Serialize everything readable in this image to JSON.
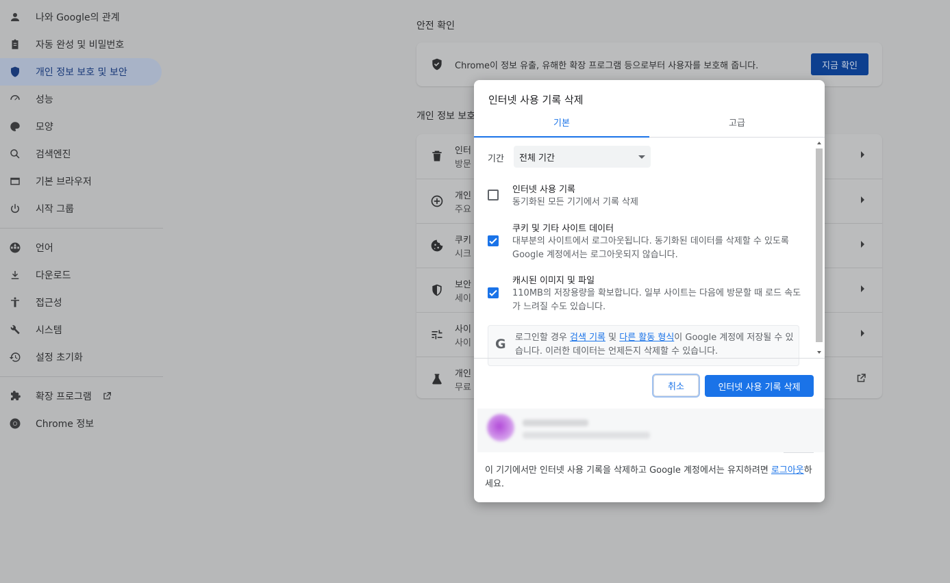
{
  "sidebar": {
    "items": [
      {
        "label": "나와 Google의 관계",
        "icon": "person-icon"
      },
      {
        "label": "자동 완성 및 비밀번호",
        "icon": "clipboard-icon"
      },
      {
        "label": "개인 정보 보호 및 보안",
        "icon": "shield-icon",
        "active": true
      },
      {
        "label": "성능",
        "icon": "speedometer-icon"
      },
      {
        "label": "모양",
        "icon": "palette-icon"
      },
      {
        "label": "검색엔진",
        "icon": "search-icon"
      },
      {
        "label": "기본 브라우저",
        "icon": "browser-icon"
      },
      {
        "label": "시작 그룹",
        "icon": "power-icon"
      },
      {
        "label": "언어",
        "icon": "globe-icon"
      },
      {
        "label": "다운로드",
        "icon": "download-icon"
      },
      {
        "label": "접근성",
        "icon": "accessibility-icon"
      },
      {
        "label": "시스템",
        "icon": "wrench-icon"
      },
      {
        "label": "설정 초기화",
        "icon": "history-icon"
      },
      {
        "label": "확장 프로그램",
        "icon": "puzzle-icon"
      },
      {
        "label": "Chrome 정보",
        "icon": "chrome-icon"
      }
    ]
  },
  "main": {
    "safety_title": "안전 확인",
    "safety_text": "Chrome이 정보 유출, 유해한 확장 프로그램 등으로부터 사용자를 보호해 줍니다.",
    "safety_button": "지금 확인",
    "privacy_title": "개인 정보 보호",
    "privacy_rows": [
      {
        "t1": "인터",
        "t2": "방문",
        "icon": "trash-icon"
      },
      {
        "t1": "개인",
        "t2": "주요",
        "icon": "compass-icon"
      },
      {
        "t1": "쿠키",
        "t2": "시크",
        "icon": "cookie-icon"
      },
      {
        "t1": "보안",
        "t2": "세이",
        "icon": "shield-icon"
      },
      {
        "t1": "사이",
        "t2": "사이",
        "icon": "tune-icon"
      },
      {
        "t1": "개인",
        "t2": "무료",
        "icon": "flask-icon"
      }
    ]
  },
  "dialog": {
    "title": "인터넷 사용 기록 삭제",
    "tabs": [
      "기본",
      "고급"
    ],
    "range_label": "기간",
    "range_value": "전체 기간",
    "options": [
      {
        "title": "인터넷 사용 기록",
        "desc": "동기화된 모든 기기에서 기록 삭제",
        "checked": false
      },
      {
        "title": "쿠키 및 기타 사이트 데이터",
        "desc": "대부분의 사이트에서 로그아웃됩니다. 동기화된 데이터를 삭제할 수 있도록 Google 계정에서는 로그아웃되지 않습니다.",
        "checked": true
      },
      {
        "title": "캐시된 이미지 및 파일",
        "desc": "110MB의 저장용량을 확보합니다. 일부 사이트는 다음에 방문할 때 로드 속도가 느려질 수도 있습니다.",
        "checked": true
      }
    ],
    "google_note": {
      "pre": "로그인할 경우 ",
      "link1": "검색 기록",
      "mid": " 및 ",
      "link2": "다른 활동 형식",
      "post": "이 Google 계정에 저장될 수 있습니다. 이러한 데이터는 언제든지 삭제할 수 있습니다."
    },
    "cancel": "취소",
    "confirm": "인터넷 사용 기록 삭제",
    "signout_pre": "이 기기에서만 인터넷 사용 기록을 삭제하고 Google 계정에서는 유지하려면 ",
    "signout_link": "로그아웃",
    "signout_post": "하세요."
  },
  "colors": {
    "accent": "#1a73e8",
    "scrim": "#000000"
  }
}
